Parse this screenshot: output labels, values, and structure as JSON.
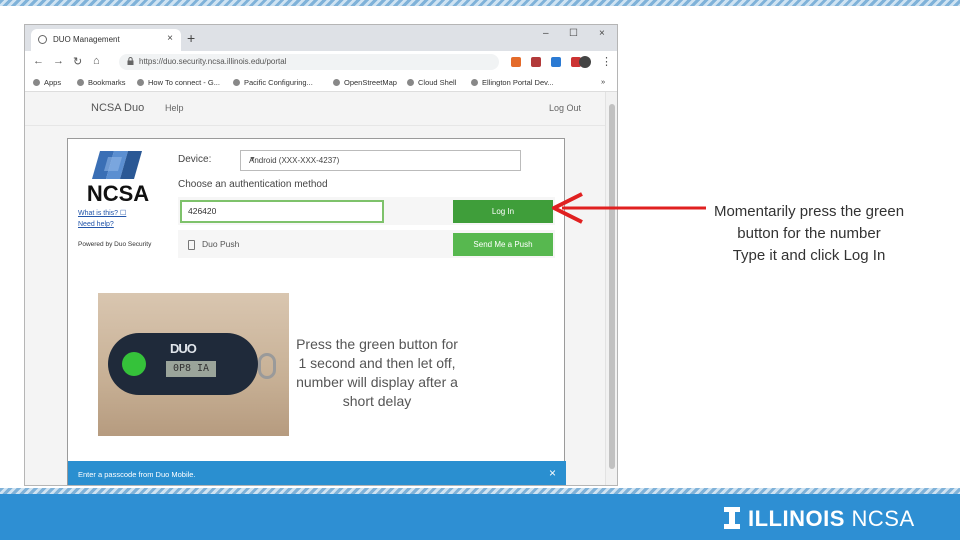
{
  "browser": {
    "tab_title": "DUO Management",
    "tab_close": "×",
    "new_tab": "+",
    "controls": {
      "minimize": "–",
      "maximize": "☐",
      "close": "×"
    },
    "url": "https://duo.security.ncsa.illinois.edu/portal",
    "bookmarks": [
      "Apps",
      "Bookmarks",
      "How To connect - G...",
      "Pacific Configuring...",
      "OpenStreetMap",
      "Cloud Shell",
      "Ellington Portal Dev..."
    ],
    "bookmarks_more": "»"
  },
  "duo": {
    "brand": "NCSA Duo",
    "help": "Help",
    "logout": "Log Out",
    "logo_text": "NCSA",
    "whats_this": "What is this? ☐",
    "need_help": "Need help?",
    "powered_by": "Powered by Duo Security",
    "device_label": "Device:",
    "device_value": "Android (XXX-XXX-4237)",
    "auth_prompt": "Choose an authentication method",
    "passcode_value": "426420",
    "login_button": "Log In",
    "push_label": "Duo Push",
    "push_button": "Send Me a Push",
    "footer_message": "Enter a passcode from Duo Mobile.",
    "footer_close": "×"
  },
  "fob": {
    "logo": "DUO",
    "display": "0P8 IA"
  },
  "photo_caption": "Press the green button for 1 second and then let off, number will display after a short delay",
  "callout_text": "Momentarily press the green button for the number\nType it and click Log In",
  "banner": {
    "brand_bold": "ILLINOIS",
    "brand_light": "NCSA"
  },
  "colors": {
    "banner": "#2e8fd3",
    "login_green": "#3f9e3a",
    "arrow_red": "#e02020"
  }
}
